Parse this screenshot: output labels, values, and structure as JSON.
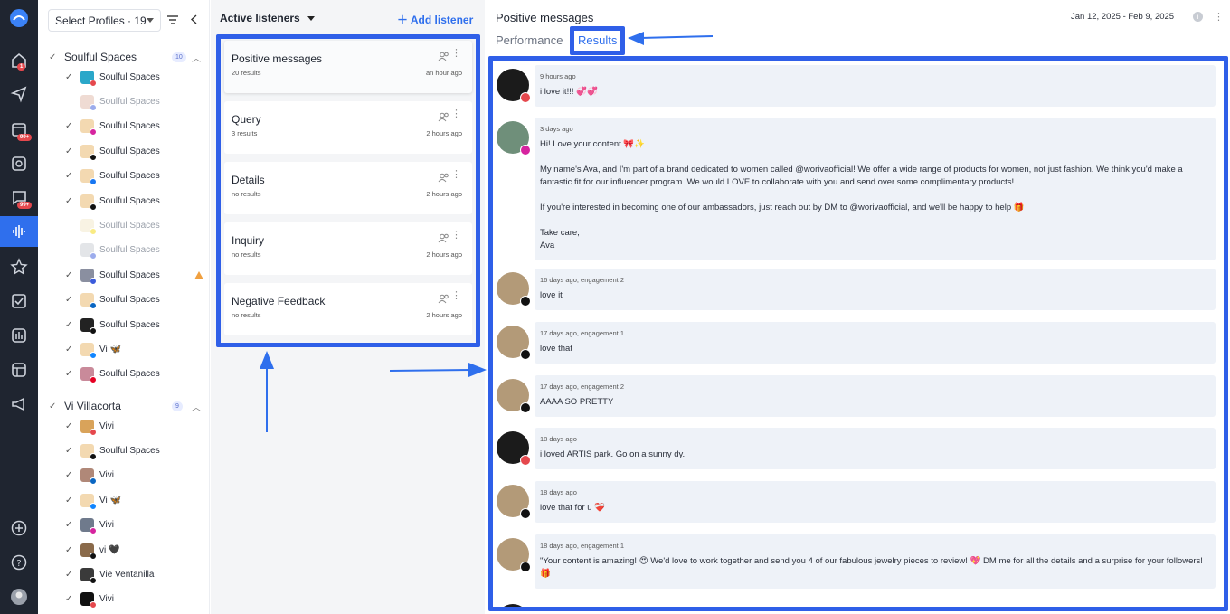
{
  "rail": {
    "icons": [
      "logo-icon",
      "home-icon",
      "send-icon",
      "calendar-icon",
      "media-icon",
      "inbox-icon",
      "listening-icon",
      "star-icon",
      "tasks-icon",
      "analytics-icon",
      "layout-icon",
      "megaphone-icon",
      "add-icon",
      "help-icon",
      "user-avatar"
    ],
    "badges": {
      "home": "1",
      "calendar": "99+",
      "inbox": "99+"
    }
  },
  "profiles": {
    "select_label": "Select Profiles · 19",
    "groups": [
      {
        "name": "Soulful Spaces",
        "count": "10"
      },
      {
        "name": "Vi Villacorta",
        "count": "9"
      }
    ],
    "items": [
      {
        "name": "Soulful Spaces",
        "checked": "✓",
        "color": "#2aa7c9",
        "net": "#e5484d"
      },
      {
        "name": "Soulful Spaces",
        "checked": "",
        "color": "#e0b8a8",
        "net": "#3b5bdb"
      },
      {
        "name": "Soulful Spaces",
        "checked": "✓",
        "color": "#f3d9b1",
        "net": "#d6249f"
      },
      {
        "name": "Soulful Spaces",
        "checked": "✓",
        "color": "#f3d9b1",
        "net": "#111111"
      },
      {
        "name": "Soulful Spaces",
        "checked": "✓",
        "color": "#f3d9b1",
        "net": "#1877f2"
      },
      {
        "name": "Soulful Spaces",
        "checked": "✓",
        "color": "#f3d9b1",
        "net": "#111111"
      },
      {
        "name": "Soulful Spaces",
        "checked": "",
        "color": "#f3e9c8",
        "net": "#f5d90a"
      },
      {
        "name": "Soulful Spaces",
        "checked": "",
        "color": "#c8ccd3",
        "net": "#3b5bdb"
      },
      {
        "name": "Soulful Spaces",
        "checked": "✓",
        "color": "#8a8fa0",
        "net": "#3b5bdb"
      },
      {
        "name": "Soulful Spaces",
        "checked": "✓",
        "color": "#f3d9b1",
        "net": "#0a66c2"
      },
      {
        "name": "Soulful Spaces",
        "checked": "✓",
        "color": "#222222",
        "net": "#111111"
      },
      {
        "name": "Vi 🦋",
        "checked": "✓",
        "color": "#f3d9b1",
        "net": "#1185fe"
      },
      {
        "name": "Soulful Spaces",
        "checked": "✓",
        "color": "#c98a9a",
        "net": "#e60023"
      },
      {
        "name": "Vivi",
        "checked": "✓",
        "color": "#d9a35a",
        "net": "#e5484d"
      },
      {
        "name": "Soulful Spaces",
        "checked": "✓",
        "color": "#f3d9b1",
        "net": "#111111"
      },
      {
        "name": "Vivi",
        "checked": "✓",
        "color": "#b08878",
        "net": "#0a66c2"
      },
      {
        "name": "Vi 🦋",
        "checked": "✓",
        "color": "#f3d9b1",
        "net": "#1185fe"
      },
      {
        "name": "Vivi",
        "checked": "✓",
        "color": "#6f7a8c",
        "net": "#d6249f"
      },
      {
        "name": "vi 🖤",
        "checked": "✓",
        "color": "#8a6a4a",
        "net": "#111111"
      },
      {
        "name": "Vie Ventanilla",
        "checked": "✓",
        "color": "#3a3a3a",
        "net": "#111111"
      },
      {
        "name": "Vivi",
        "checked": "✓",
        "color": "#111111",
        "net": "#e5484d"
      }
    ]
  },
  "listeners": {
    "header": "Active listeners",
    "add_label": "Add listener",
    "cards": [
      {
        "title": "Positive messages",
        "sub": "20 results",
        "time": "an hour ago"
      },
      {
        "title": "Query",
        "sub": "3 results",
        "time": "2 hours ago"
      },
      {
        "title": "Details",
        "sub": "no results",
        "time": "2 hours ago"
      },
      {
        "title": "Inquiry",
        "sub": "no results",
        "time": "2 hours ago"
      },
      {
        "title": "Negative Feedback",
        "sub": "no results",
        "time": "2 hours ago"
      }
    ]
  },
  "main": {
    "title": "Positive messages",
    "date_range": "Jan 12, 2025 - Feb 9, 2025",
    "tabs": {
      "performance": "Performance",
      "results": "Results"
    },
    "feed": [
      {
        "meta": "9 hours ago",
        "text": "i love it!!! 💞💞",
        "pic": "#1b1b1b",
        "net": "#e5484d"
      },
      {
        "meta": "3 days ago",
        "text": "Hi! Love your content 🎀✨\n\nMy name's Ava, and I'm part of a brand dedicated to women called @worivaofficial! We offer a wide range of products for women, not just fashion. We think you'd make a fantastic fit for our influencer program. We would LOVE to collaborate with you and send over some complimentary products!\n\nIf you're interested in becoming one of our ambassadors, just reach out by DM to @worivaofficial, and we'll be happy to help 🎁\n\nTake care,\nAva",
        "pic": "#6f8f7a",
        "net": "#d6249f"
      },
      {
        "meta": "16 days ago, engagement 2",
        "text": "love it",
        "pic": "#b39a78",
        "net": "#111111"
      },
      {
        "meta": "17 days ago, engagement 1",
        "text": "love that",
        "pic": "#b39a78",
        "net": "#111111"
      },
      {
        "meta": "17 days ago, engagement 2",
        "text": "AAAA SO PRETTY",
        "pic": "#b39a78",
        "net": "#111111"
      },
      {
        "meta": "18 days ago",
        "text": "i loved ARTIS park. Go on a sunny dy.",
        "pic": "#1b1b1b",
        "net": "#e5484d"
      },
      {
        "meta": "18 days ago",
        "text": "love that for u ❤️‍🩹",
        "pic": "#b39a78",
        "net": "#111111"
      },
      {
        "meta": "18 days ago, engagement 1",
        "text": "\"Your content is amazing! 😍 We'd love to work together and send you 4 of our fabulous jewelry pieces to review! 💖 DM me for all the details and a surprise for your followers!🎁",
        "pic": "#b39a78",
        "net": "#111111"
      }
    ]
  }
}
